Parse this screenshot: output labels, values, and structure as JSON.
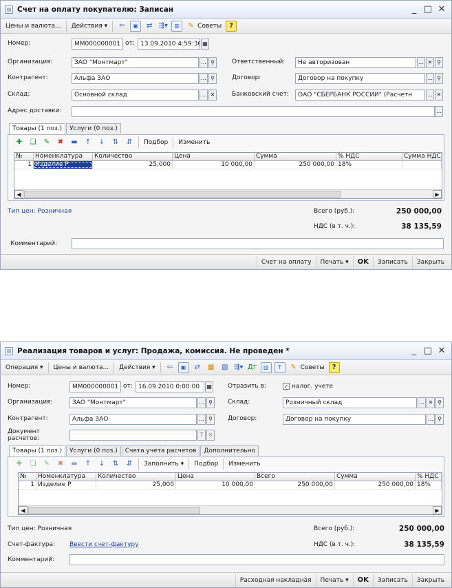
{
  "w1": {
    "title": "Счет на оплату покупателю: Записан",
    "toolbar": {
      "prices": "Цены и валюта...",
      "actions": "Действия",
      "tips": "Советы"
    },
    "number_label": "Номер:",
    "number": "ММ000000001",
    "from_label": "от:",
    "date": "13.09.2010 4:59:36",
    "org_label": "Организация:",
    "org": "ЗАО \"Монтмарт\"",
    "resp_label": "Ответственный:",
    "resp": "Не авторизован",
    "contr_label": "Контрагент:",
    "contr": "Альфа ЗАО",
    "contract_label": "Договор:",
    "contract": "Договор на покупку",
    "wh_label": "Склад:",
    "wh": "Основной склад",
    "bank_label": "Банковский счет:",
    "bank": "ОАО \"СБЕРБАНК РОССИИ\" (Расчетн",
    "addr_label": "Адрес доставки:",
    "addr": "",
    "tabs": [
      "Товары (1 поз.)",
      "Услуги (0 поз.)"
    ],
    "subtb": {
      "pick": "Подбор",
      "change": "Изменить"
    },
    "cols": [
      "№",
      "Номенклатура",
      "Количество",
      "Цена",
      "Сумма",
      "% НДС",
      "Сумма НДС"
    ],
    "rows": [
      {
        "n": "1",
        "item": "Изделие Р",
        "qty": "25,000",
        "price": "10 000,00",
        "sum": "250 000,00",
        "vat": "18%",
        "vatsum": ""
      }
    ],
    "price_type": "Тип цен: Розничная",
    "total_label": "Всего (руб.):",
    "total": "250 000,00",
    "vat_label": "НДС (в т. ч.):",
    "vat_total": "38 135,59",
    "comment_label": "Комментарий:",
    "comment": "",
    "bottom": {
      "invoice": "Счет на оплату",
      "print": "Печать",
      "ok": "OK",
      "save": "Записать",
      "close": "Закрыть"
    }
  },
  "w2": {
    "title": "Реализация товаров и услуг: Продажа, комиссия. Не проведен *",
    "toolbar": {
      "operation": "Операция",
      "prices": "Цены и валюта...",
      "actions": "Действия",
      "tips": "Советы"
    },
    "number_label": "Номер:",
    "number": "ММ000000001",
    "from_label": "от:",
    "date": "16.09.2010 0:00:00",
    "reflect_label": "Отразить в:",
    "reflect_chk": "налог. учете",
    "org_label": "Организация:",
    "org": "ЗАО \"Монтмарт\"",
    "wh_label": "Склад:",
    "wh": "Розничный склад",
    "contr_label": "Контрагент:",
    "contr": "Альфа ЗАО",
    "contract_label": "Договор:",
    "contract": "Договор на покупку",
    "doc_label": "Документ расчетов:",
    "doc": "",
    "tabs": [
      "Товары (1 поз.)",
      "Услуги (0 поз.)",
      "Счета учета расчетов",
      "Дополнительно"
    ],
    "subtb": {
      "fill": "Заполнить",
      "pick": "Подбор",
      "change": "Изменить"
    },
    "cols": [
      "№",
      "Номенклатура",
      "Количество",
      "Цена",
      "Всего",
      "Сумма",
      "% НДС"
    ],
    "rows": [
      {
        "n": "1",
        "item": "Изделие Р",
        "qty": "25,000",
        "price": "10 000,00",
        "total": "250 000,00",
        "sum": "250 000,00",
        "vat": "18%"
      }
    ],
    "price_type": "Тип цен: Розничная",
    "invoice_label": "Счет-фактура:",
    "invoice_link": "Ввести счет-фактуру",
    "total_label": "Всего (руб.):",
    "total": "250 000,00",
    "vat_label": "НДС (в т. ч.):",
    "vat_total": "38 135,59",
    "comment_label": "Комментарий:",
    "comment": "",
    "bottom": {
      "waybill": "Расходная накладная",
      "print": "Печать",
      "ok": "OK",
      "save": "Записать",
      "close": "Закрыть"
    }
  }
}
